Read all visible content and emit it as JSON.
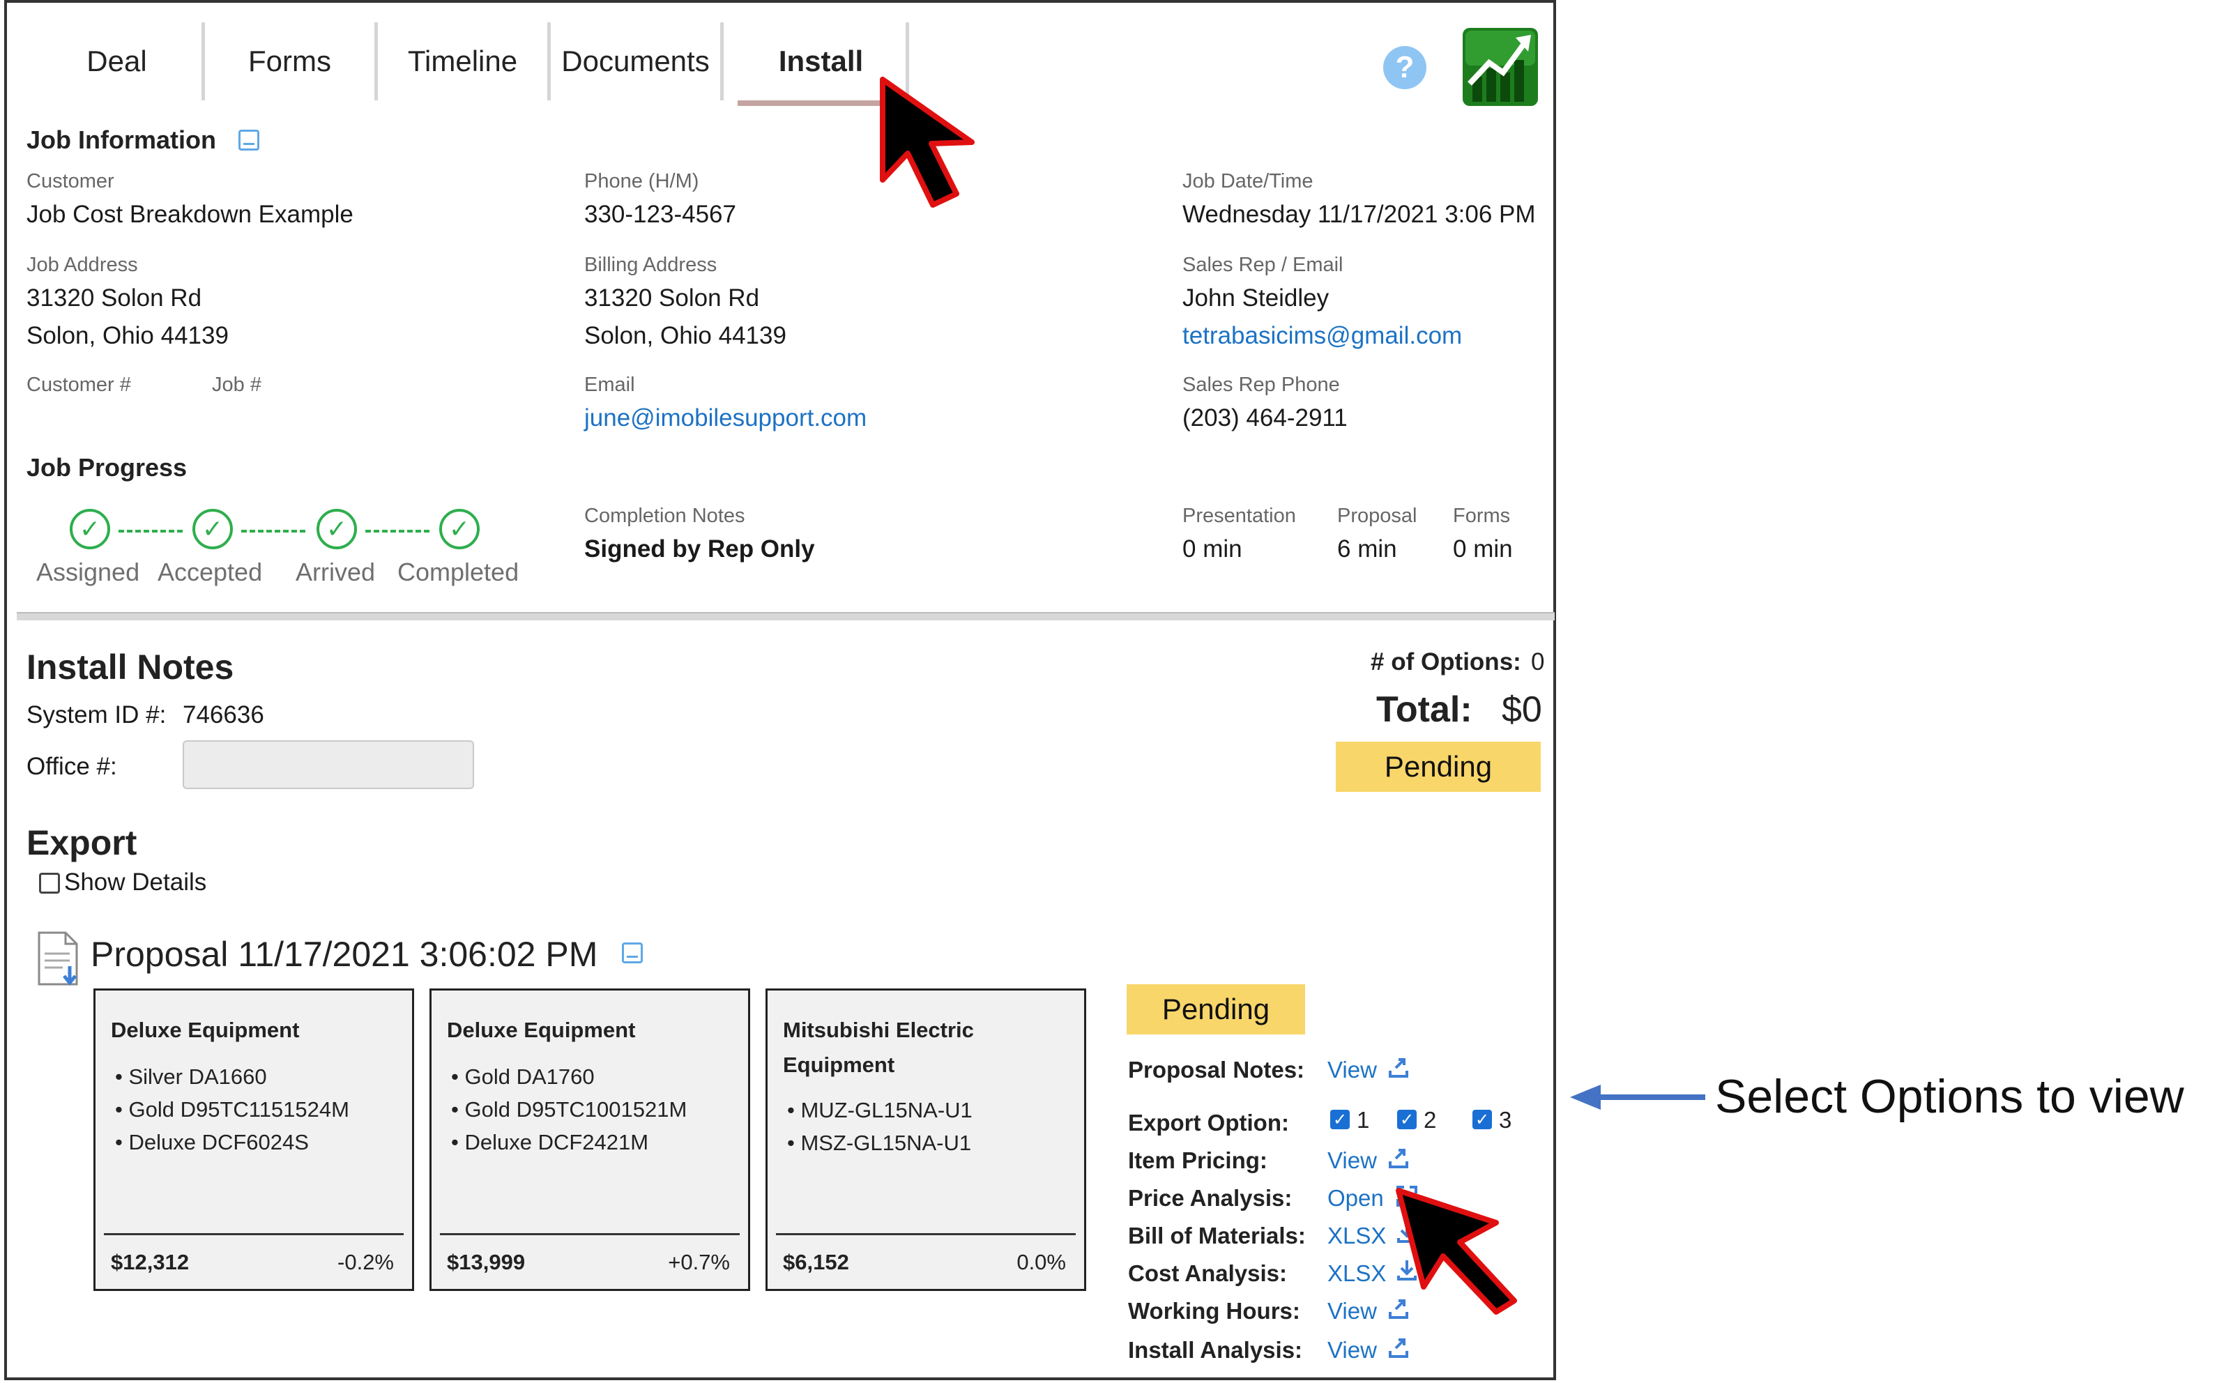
{
  "tabs": [
    {
      "label": "Deal"
    },
    {
      "label": "Forms"
    },
    {
      "label": "Timeline"
    },
    {
      "label": "Documents"
    },
    {
      "label": "Install"
    }
  ],
  "job_info": {
    "title": "Job Information",
    "customer_label": "Customer",
    "customer": "Job Cost Breakdown Example",
    "phone_label": "Phone (H/M)",
    "phone": "330-123-4567",
    "job_date_label": "Job Date/Time",
    "job_date": "Wednesday 11/17/2021 3:06 PM",
    "job_address_label": "Job Address",
    "job_address_line1": "31320 Solon Rd",
    "job_address_line2": "Solon, Ohio 44139",
    "billing_address_label": "Billing Address",
    "billing_address_line1": "31320 Solon Rd",
    "billing_address_line2": "Solon, Ohio 44139",
    "sales_rep_label": "Sales Rep / Email",
    "sales_rep": "John Steidley",
    "sales_rep_email": "tetrabasicims@gmail.com",
    "customer_num_label": "Customer #",
    "job_num_label": "Job #",
    "email_label": "Email",
    "email": "june@imobilesupport.com",
    "sales_rep_phone_label": "Sales Rep Phone",
    "sales_rep_phone": "(203) 464-2911"
  },
  "job_progress": {
    "title": "Job Progress",
    "steps": [
      "Assigned",
      "Accepted",
      "Arrived",
      "Completed"
    ],
    "completion_notes_label": "Completion Notes",
    "completion_notes": "Signed by Rep Only",
    "times": [
      {
        "label": "Presentation",
        "value": "0 min"
      },
      {
        "label": "Proposal",
        "value": "6 min"
      },
      {
        "label": "Forms",
        "value": "0 min"
      }
    ]
  },
  "install_notes": {
    "title": "Install Notes",
    "system_id_label": "System ID #:",
    "system_id": "746636",
    "office_label": "Office #:",
    "office_value": "",
    "options_label": "# of Options:",
    "options_count": "0",
    "total_label": "Total:",
    "total_value": "$0",
    "status": "Pending"
  },
  "export": {
    "title": "Export",
    "show_details_label": "Show Details"
  },
  "proposal": {
    "title": "Proposal 11/17/2021 3:06:02 PM",
    "status": "Pending",
    "cards": [
      {
        "title": "Deluxe Equipment",
        "items": [
          "Silver DA1660",
          "Gold D95TC1151524M",
          "Deluxe DCF6024S"
        ],
        "price": "$12,312",
        "pct": "-0.2%"
      },
      {
        "title": "Deluxe Equipment",
        "items": [
          "Gold DA1760",
          "Gold D95TC1001521M",
          "Deluxe DCF2421M"
        ],
        "price": "$13,999",
        "pct": "+0.7%"
      },
      {
        "title": "Mitsubishi Electric Equipment",
        "items": [
          "MUZ-GL15NA-U1",
          "MSZ-GL15NA-U1"
        ],
        "price": "$6,152",
        "pct": "0.0%"
      }
    ],
    "details": {
      "proposal_notes_label": "Proposal Notes:",
      "proposal_notes_link": "View",
      "export_option_label": "Export Option:",
      "export_options": [
        "1",
        "2",
        "3"
      ],
      "item_pricing_label": "Item Pricing:",
      "item_pricing_link": "View",
      "price_analysis_label": "Price Analysis:",
      "price_analysis_link": "Open",
      "bom_label": "Bill of Materials:",
      "bom_link": "XLSX",
      "cost_analysis_label": "Cost Analysis:",
      "cost_analysis_link": "XLSX",
      "working_hours_label": "Working Hours:",
      "working_hours_link": "View",
      "install_analysis_label": "Install Analysis:",
      "install_analysis_link": "View"
    }
  },
  "annotation": {
    "text": "Select Options to view"
  },
  "colors": {
    "link": "#1c72c4",
    "pending": "#f8d66a",
    "progress_green": "#2eae4d",
    "checkbox_blue": "#1a6fd4",
    "arrow_blue": "#4472c4"
  }
}
